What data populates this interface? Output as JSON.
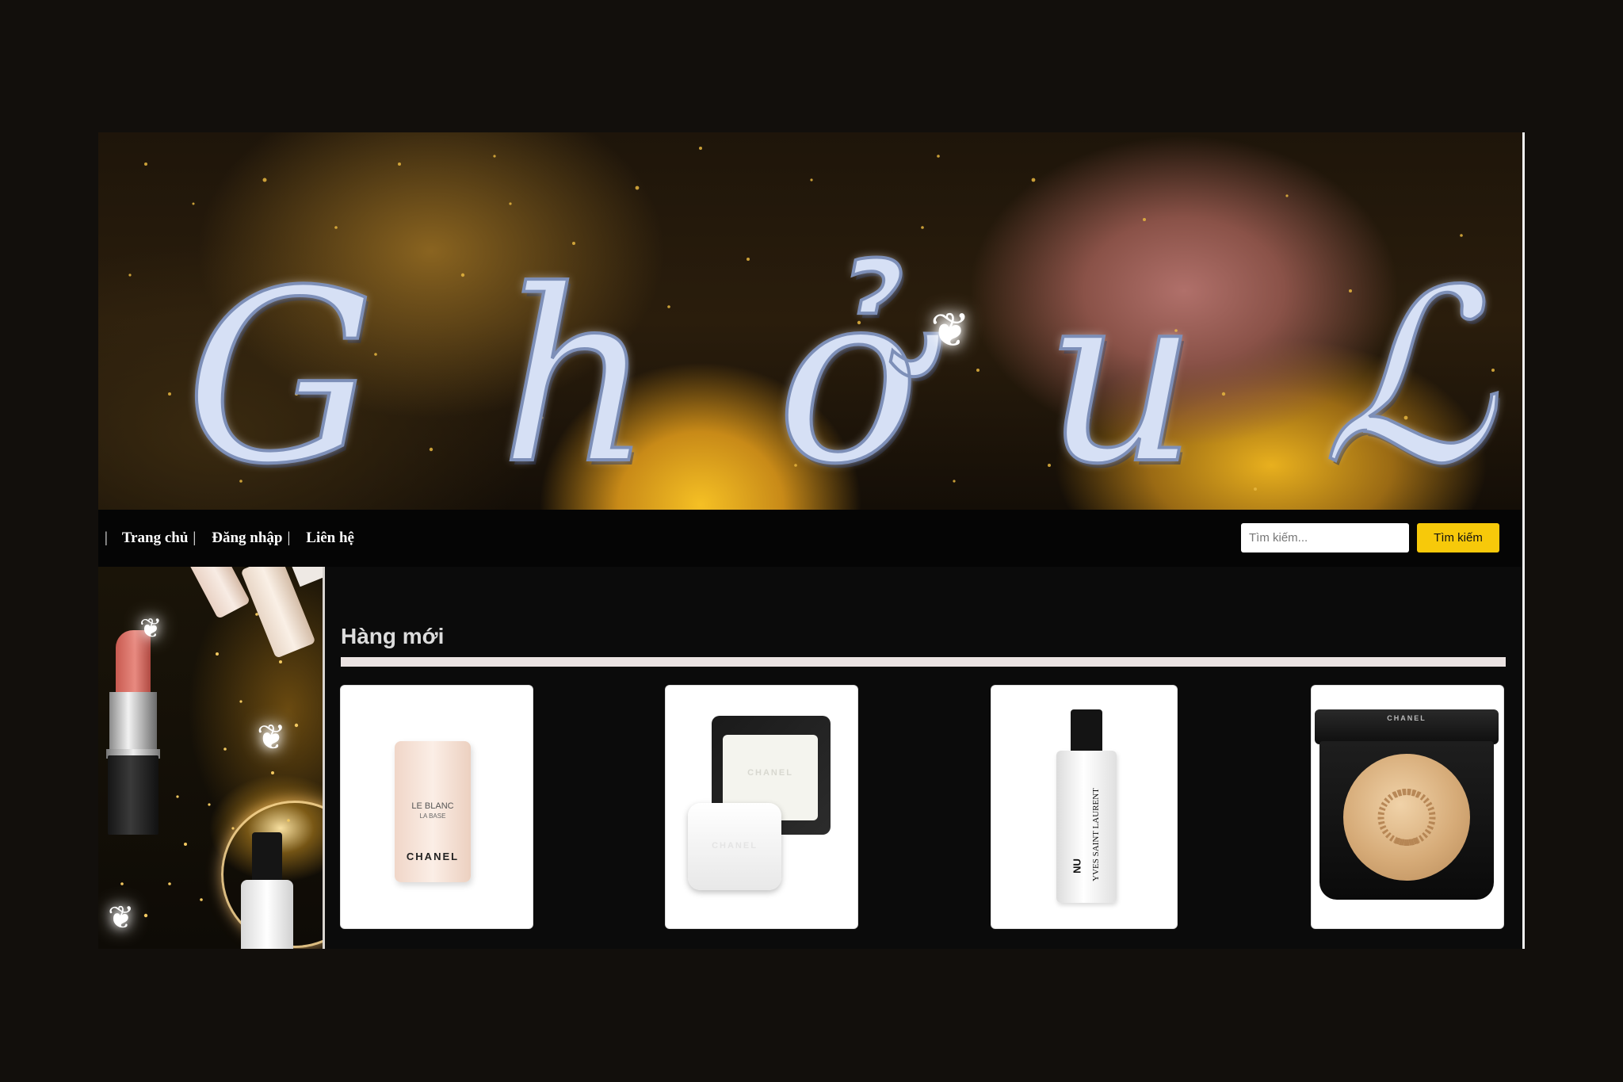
{
  "banner": {
    "logo_letters": [
      "G",
      "h",
      "ở",
      "u",
      "ℒ"
    ]
  },
  "nav": {
    "separator": "|",
    "links": [
      {
        "label": "Trang chủ"
      },
      {
        "label": "Đăng nhập"
      },
      {
        "label": "Liên hệ"
      }
    ]
  },
  "search": {
    "placeholder": "Tìm kiếm...",
    "button_label": "Tìm kiếm"
  },
  "main": {
    "section_title": "Hàng mới",
    "products": [
      {
        "brand": "CHANEL",
        "product_lines": [
          "LE BLANC",
          "LA BASE"
        ]
      },
      {
        "brand": "CHANEL"
      },
      {
        "brand": "YVES SAINT LAURENT",
        "product_line": "NU"
      },
      {
        "brand": "CHANEL"
      }
    ]
  },
  "colors": {
    "background": "#120f0c",
    "nav_background": "#050505",
    "search_button": "#f7c90a",
    "section_rule": "#ebe3e2"
  }
}
